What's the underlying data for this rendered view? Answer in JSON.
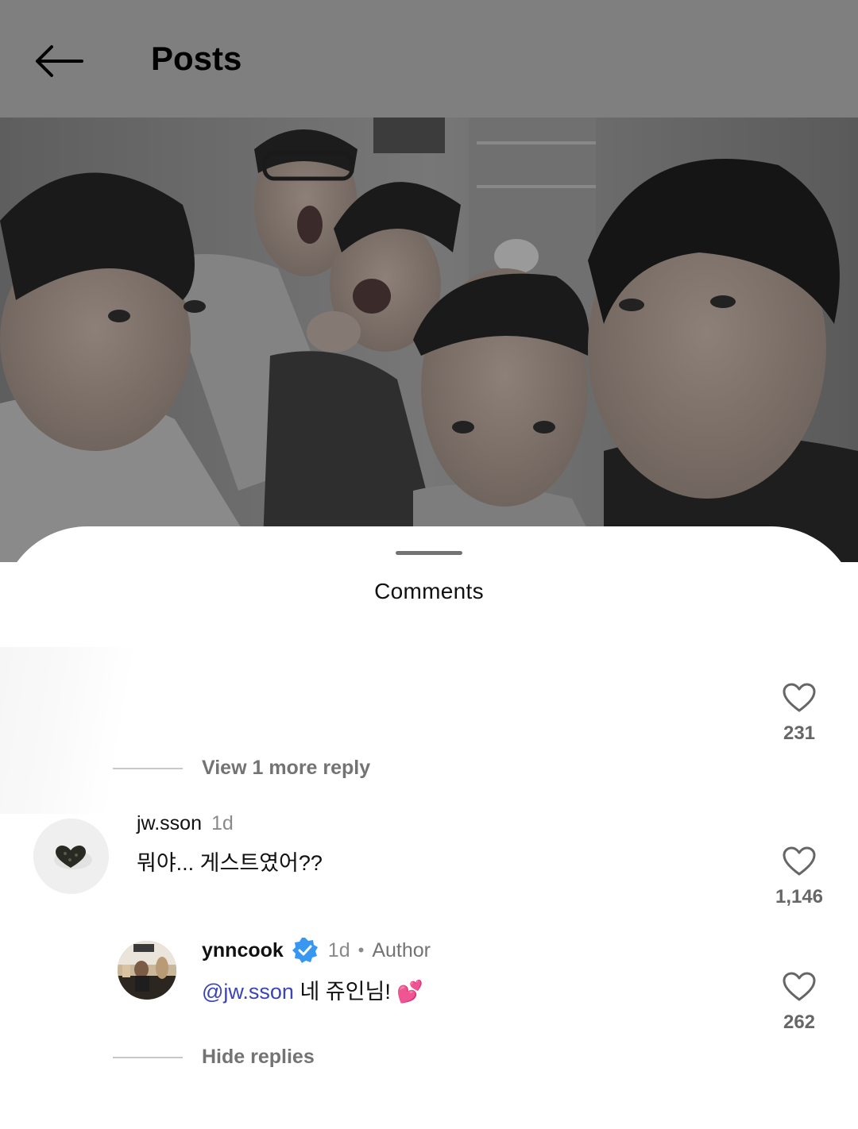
{
  "header": {
    "title": "Posts",
    "back_icon": "arrow-left-icon"
  },
  "sheet": {
    "title": "Comments"
  },
  "threads": {
    "first": {
      "like_count": "231",
      "view_replies": "View 1 more reply"
    },
    "second": {
      "comment": {
        "username": "jw.sson",
        "time": "1d",
        "text": "뭐야... 게스트였어??",
        "like_count": "1,146"
      },
      "reply": {
        "username": "ynncook",
        "verified": true,
        "time": "1d",
        "separator": "•",
        "author_label": "Author",
        "mention": "@jw.sson",
        "text": " 네 쥬인님!",
        "emoji": "💕",
        "like_count": "262"
      },
      "hide_replies": "Hide replies"
    }
  },
  "colors": {
    "header_bg": "#7f7f7f",
    "mention": "#3b44b8",
    "verified": "#3897f0"
  }
}
